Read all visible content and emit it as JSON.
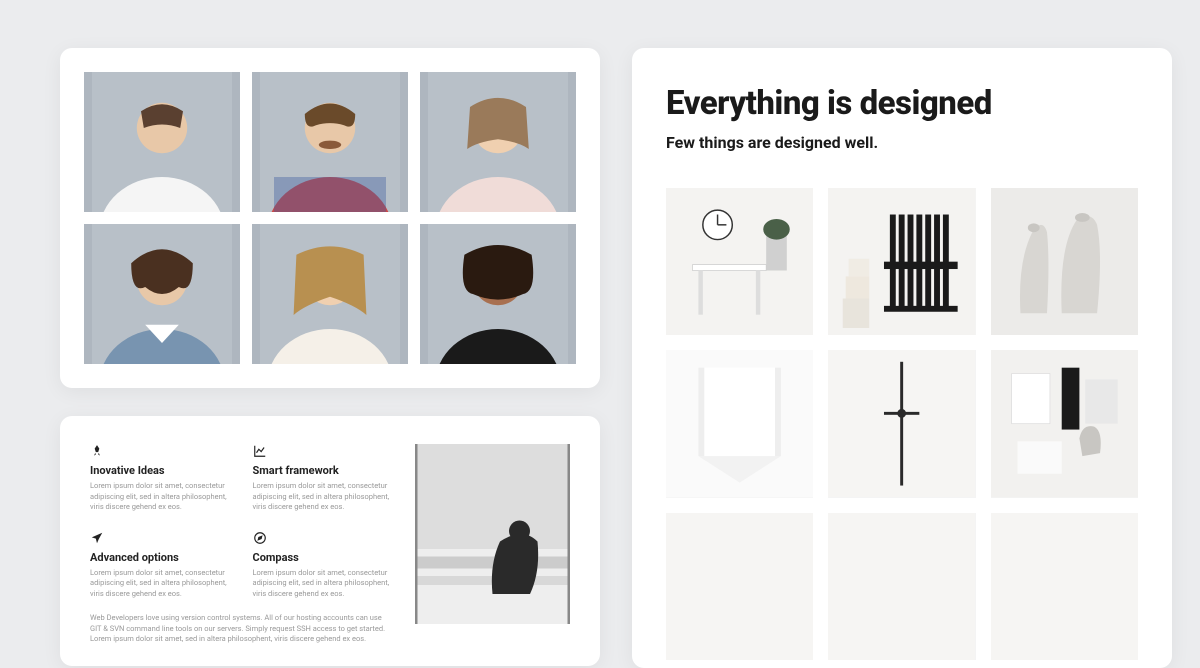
{
  "gallery": {
    "heading": "Everything is designed",
    "subheading": "Few things are designed well."
  },
  "features": {
    "items": [
      {
        "title": "Inovative Ideas",
        "body": "Lorem ipsum dolor sit amet, consectetur adipiscing elit, sed in altera philosophent, viris discere gehend ex eos."
      },
      {
        "title": "Smart framework",
        "body": "Lorem ipsum dolor sit amet, consectetur adipiscing elit, sed in altera philosophent, viris discere gehend ex eos."
      },
      {
        "title": "Advanced options",
        "body": "Lorem ipsum dolor sit amet, consectetur adipiscing elit, sed in altera philosophent, viris discere gehend ex eos."
      },
      {
        "title": "Compass",
        "body": "Lorem ipsum dolor sit amet, consectetur adipiscing elit, sed in altera philosophent, viris discere gehend ex eos."
      }
    ],
    "footer": "Web Developers love using version control systems. All of our hosting accounts can use GIT & SVN command line tools on our servers. Simply request SSH access to get started. Lorem ipsum dolor sit amet, sed in altera philosophent, viris discere gehend ex eos."
  }
}
